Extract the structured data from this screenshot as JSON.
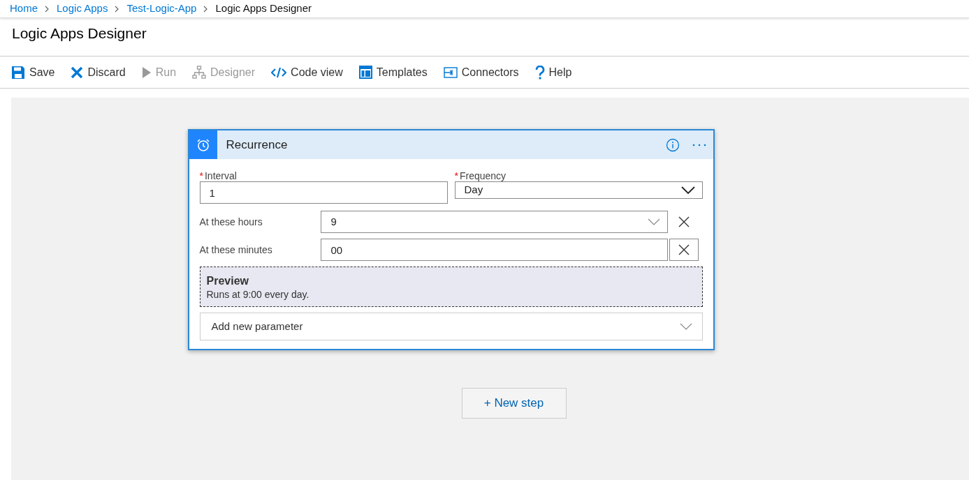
{
  "breadcrumb": [
    {
      "label": "Home",
      "current": false
    },
    {
      "label": "Logic Apps",
      "current": false
    },
    {
      "label": "Test-Logic-App",
      "current": false
    },
    {
      "label": "Logic Apps Designer",
      "current": true
    }
  ],
  "page_title": "Logic Apps Designer",
  "toolbar": [
    {
      "kind": "save",
      "label": "Save",
      "disabled": false
    },
    {
      "kind": "discard",
      "label": "Discard",
      "disabled": false
    },
    {
      "kind": "run",
      "label": "Run",
      "disabled": true
    },
    {
      "kind": "designer",
      "label": "Designer",
      "disabled": true
    },
    {
      "kind": "code",
      "label": "Code view",
      "disabled": false
    },
    {
      "kind": "templates",
      "label": "Templates",
      "disabled": false
    },
    {
      "kind": "connectors",
      "label": "Connectors",
      "disabled": false
    },
    {
      "kind": "help",
      "label": "Help",
      "disabled": false
    }
  ],
  "card": {
    "title": "Recurrence",
    "required_fields": [
      {
        "label": "Interval",
        "required_mark": "*",
        "value": "1",
        "kind": "text"
      },
      {
        "label": "Frequency",
        "required_mark": "*",
        "value": "Day",
        "kind": "dropdown"
      }
    ],
    "parameters": [
      {
        "label": "At these hours",
        "value": "9",
        "kind": "dropdown"
      },
      {
        "label": "At these minutes",
        "value": "00",
        "kind": "text"
      }
    ],
    "preview": {
      "title": "Preview",
      "text": "Runs at 9:00 every day."
    },
    "add_parameter": "Add new parameter"
  },
  "new_step": "+ New step"
}
